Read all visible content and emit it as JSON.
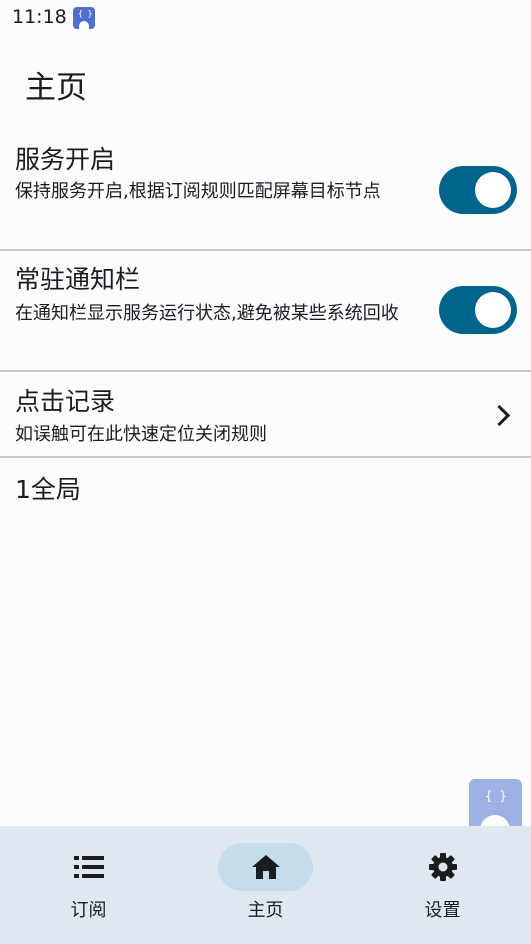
{
  "status_bar": {
    "time": "11:18",
    "app_icon": "app-notification-icon"
  },
  "page": {
    "title": "主页"
  },
  "settings": [
    {
      "title": "服务开启",
      "desc": "保持服务开启,根据订阅规则匹配屏幕目标节点",
      "control": "switch",
      "enabled": true
    },
    {
      "title": "常驻通知栏",
      "desc": "在通知栏显示服务运行状态,避免被某些系统回收",
      "control": "switch",
      "enabled": true
    },
    {
      "title": "点击记录",
      "desc": "如误触可在此快速定位关闭规则",
      "control": "chevron",
      "icon": "chevron-right-icon"
    }
  ],
  "global_count": "1全局",
  "nav": {
    "items": [
      {
        "label": "订阅",
        "icon": "list-icon",
        "active": false
      },
      {
        "label": "主页",
        "icon": "home-icon",
        "active": true
      },
      {
        "label": "设置",
        "icon": "gear-icon",
        "active": false
      }
    ]
  },
  "colors": {
    "accent": "#00658d",
    "nav_background": "#dfe8f0",
    "nav_active_pill": "#c5dcec",
    "background": "#fcfcff"
  }
}
